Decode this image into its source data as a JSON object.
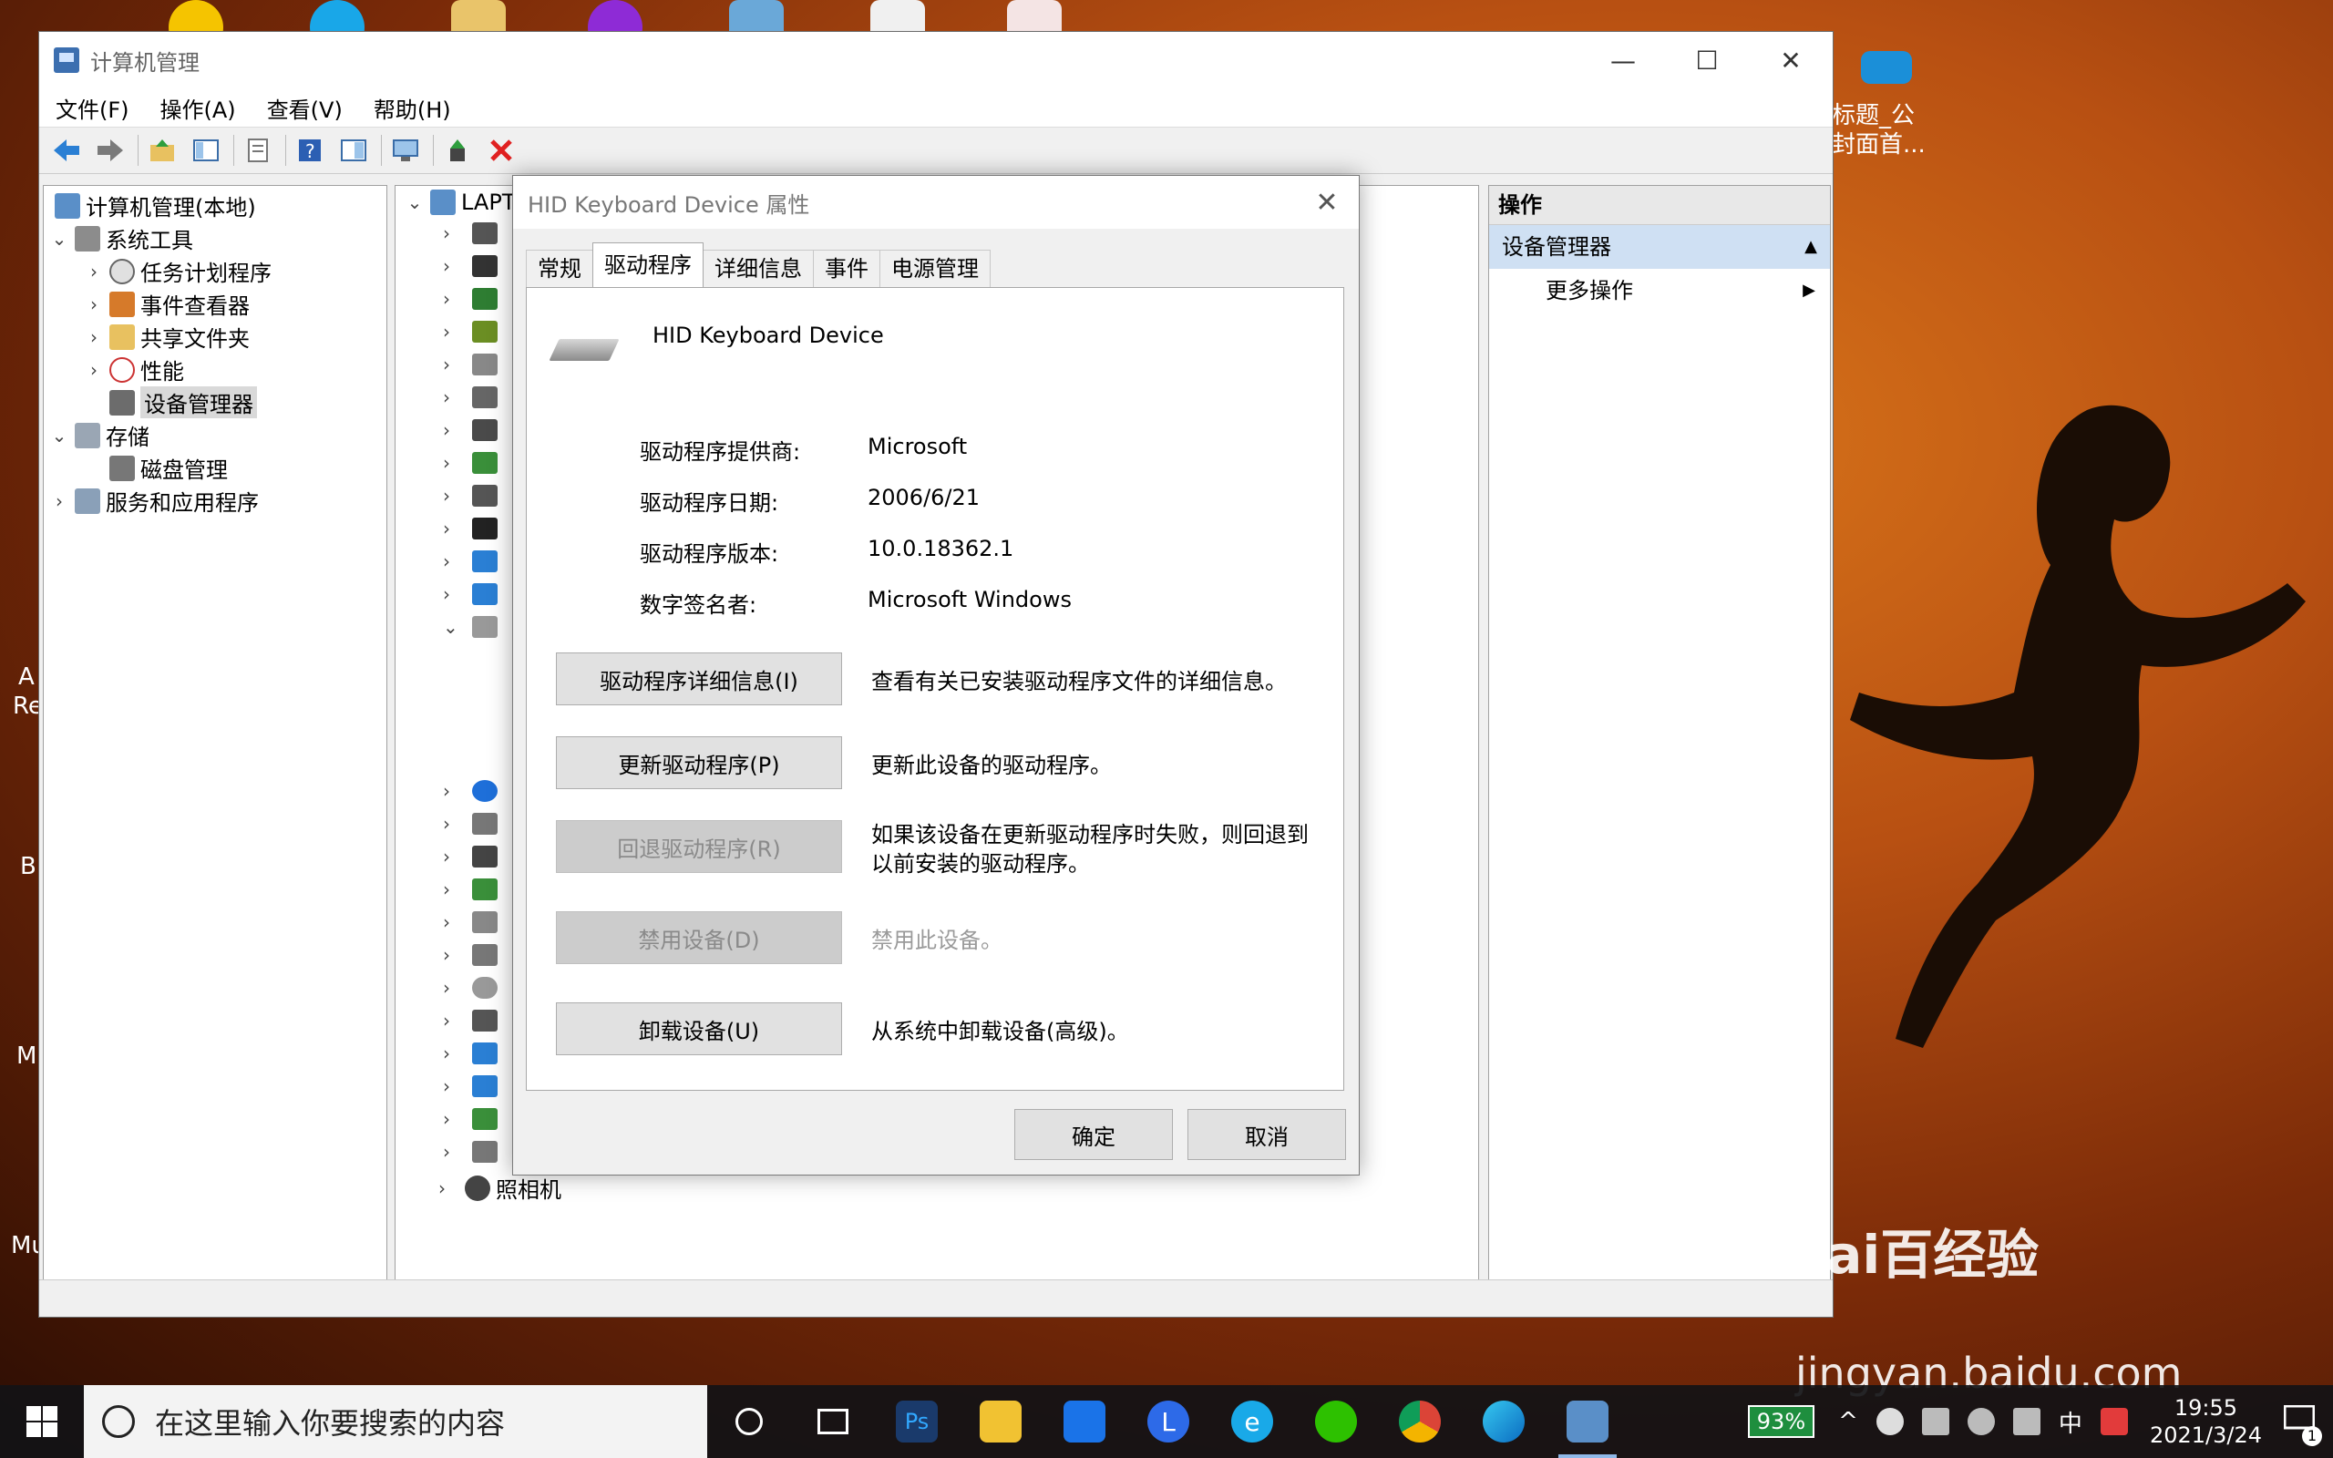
{
  "desktop": {
    "right_icon_label_1": "标题_公",
    "right_icon_label_2": "封面首...",
    "left_edge_labels": [
      "A",
      "Re",
      "B",
      "M",
      "Mu"
    ],
    "watermark_brand": "Bai百经验",
    "watermark_url": "jingyan.baidu.com"
  },
  "window": {
    "title": "计算机管理",
    "controls": {
      "minimize": "—",
      "maximize": "☐",
      "close": "✕"
    },
    "menu": [
      "文件(F)",
      "操作(A)",
      "查看(V)",
      "帮助(H)"
    ]
  },
  "left_tree": {
    "root": "计算机管理(本地)",
    "system_tools": "系统工具",
    "task_scheduler": "任务计划程序",
    "event_viewer": "事件查看器",
    "shared_folders": "共享文件夹",
    "performance": "性能",
    "device_manager": "设备管理器",
    "storage": "存储",
    "disk_management": "磁盘管理",
    "services_apps": "服务和应用程序"
  },
  "mid_tree": {
    "root_prefix": "LAPT",
    "camera": "照相机"
  },
  "actions_pane": {
    "header": "操作",
    "section": "设备管理器",
    "more": "更多操作"
  },
  "dialog": {
    "title": "HID Keyboard Device 属性",
    "close": "✕",
    "tabs": [
      "常规",
      "驱动程序",
      "详细信息",
      "事件",
      "电源管理"
    ],
    "active_tab": "驱动程序",
    "device_name": "HID Keyboard Device",
    "fields": {
      "provider_label": "驱动程序提供商:",
      "provider_value": "Microsoft",
      "date_label": "驱动程序日期:",
      "date_value": "2006/6/21",
      "version_label": "驱动程序版本:",
      "version_value": "10.0.18362.1",
      "signer_label": "数字签名者:",
      "signer_value": "Microsoft Windows"
    },
    "buttons": {
      "details": "驱动程序详细信息(I)",
      "details_desc": "查看有关已安装驱动程序文件的详细信息。",
      "update": "更新驱动程序(P)",
      "update_desc": "更新此设备的驱动程序。",
      "rollback": "回退驱动程序(R)",
      "rollback_desc": "如果该设备在更新驱动程序时失败，则回退到以前安装的驱动程序。",
      "disable": "禁用设备(D)",
      "disable_desc": "禁用此设备。",
      "uninstall": "卸载设备(U)",
      "uninstall_desc": "从系统中卸载设备(高级)。"
    },
    "ok": "确定",
    "cancel": "取消"
  },
  "taskbar": {
    "search_placeholder": "在这里输入你要搜索的内容",
    "battery": "93%",
    "ime": "中",
    "time": "19:55",
    "date": "2021/3/24",
    "notification_count": "1"
  }
}
